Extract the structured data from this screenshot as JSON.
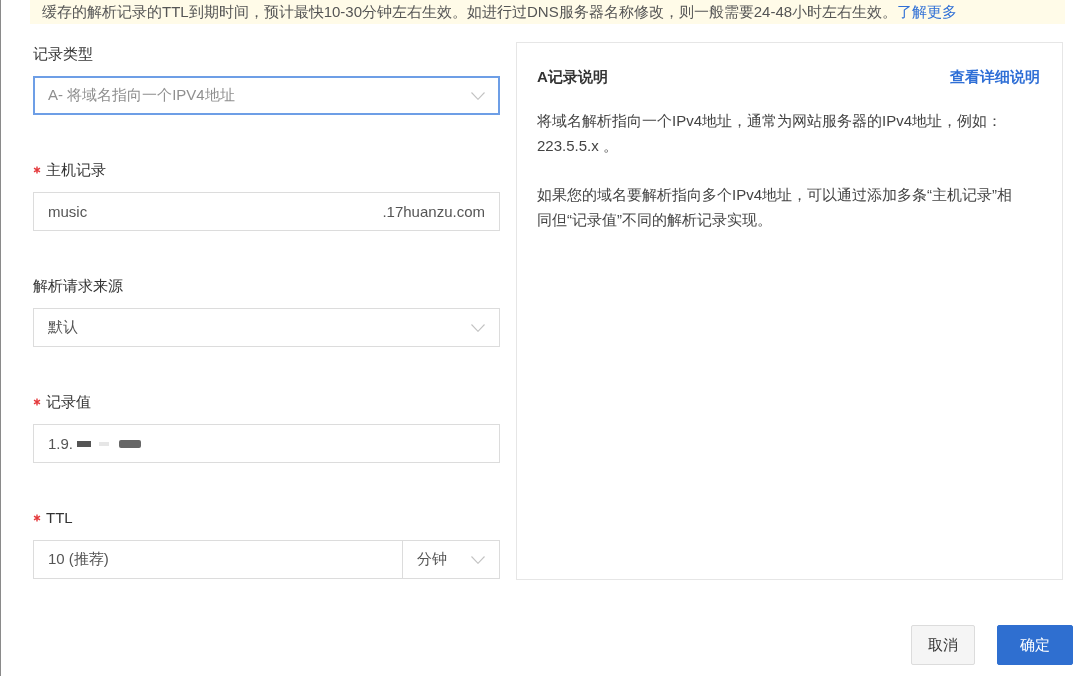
{
  "notice": {
    "text": "缓存的解析记录的TTL到期时间，预计最快10-30分钟左右生效。如进行过DNS服务器名称修改，则一般需要24-48小时左右生效。",
    "link": "了解更多"
  },
  "form": {
    "fields": [
      {
        "kind": "select",
        "label": "记录类型",
        "required": false,
        "focused": true,
        "value": "A- 将域名指向一个IPV4地址"
      },
      {
        "kind": "input",
        "label": "主机记录",
        "required": true,
        "focused": false,
        "value": "music",
        "suffix": ".17huanzu.com"
      },
      {
        "kind": "select",
        "label": "解析请求来源",
        "required": false,
        "focused": false,
        "value": "默认"
      },
      {
        "kind": "input",
        "label": "记录值",
        "required": true,
        "focused": false,
        "value": "1.9.",
        "redacted": true
      },
      {
        "kind": "input_unit",
        "label": "TTL",
        "required": true,
        "focused": false,
        "value": "10 (推荐)",
        "unit": "分钟"
      }
    ]
  },
  "help_panel": {
    "title": "A记录说明",
    "link": "查看详细说明",
    "paragraphs": [
      "将域名解析指向一个IPv4地址，通常为网站服务器的IPv4地址，例如：223.5.5.x 。",
      "如果您的域名要解析指向多个IPv4地址，可以通过添加多条“主机记录”相同但“记录值”不同的解析记录实现。"
    ]
  },
  "buttons": [
    {
      "label": "取消",
      "kind": "secondary"
    },
    {
      "label": "确定",
      "kind": "primary"
    }
  ]
}
